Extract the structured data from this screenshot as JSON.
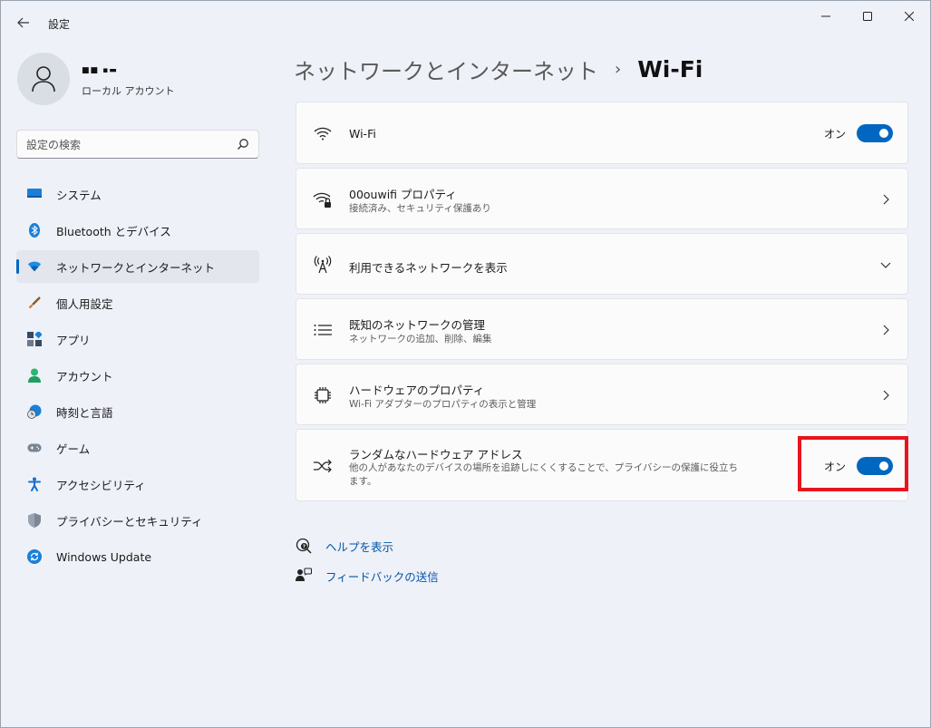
{
  "window": {
    "title": "設定",
    "controls": [
      "minimize-icon",
      "maximize-icon",
      "close-icon"
    ]
  },
  "user": {
    "name": "■■ ▪▬",
    "account_type": "ローカル アカウント"
  },
  "search": {
    "placeholder": "設定の検索"
  },
  "sidebar": {
    "items": [
      {
        "label": "システム",
        "icon": "system-icon",
        "active": false
      },
      {
        "label": "Bluetooth とデバイス",
        "icon": "bluetooth-icon",
        "active": false
      },
      {
        "label": "ネットワークとインターネット",
        "icon": "network-icon",
        "active": true
      },
      {
        "label": "個人用設定",
        "icon": "brush-icon",
        "active": false
      },
      {
        "label": "アプリ",
        "icon": "apps-icon",
        "active": false
      },
      {
        "label": "アカウント",
        "icon": "account-icon",
        "active": false
      },
      {
        "label": "時刻と言語",
        "icon": "time-language-icon",
        "active": false
      },
      {
        "label": "ゲーム",
        "icon": "gamepad-icon",
        "active": false
      },
      {
        "label": "アクセシビリティ",
        "icon": "accessibility-icon",
        "active": false
      },
      {
        "label": "プライバシーとセキュリティ",
        "icon": "shield-icon",
        "active": false
      },
      {
        "label": "Windows Update",
        "icon": "windows-update-icon",
        "active": false
      }
    ]
  },
  "breadcrumb": {
    "parent": "ネットワークとインターネット",
    "separator": "›",
    "current": "Wi-Fi"
  },
  "main": {
    "wifi": {
      "title": "Wi-Fi",
      "toggle_label": "オン",
      "toggle_on": true
    },
    "properties": {
      "title": "00ouwifi プロパティ",
      "subtitle": "接続済み、セキュリティ保護あり"
    },
    "available": {
      "title": "利用できるネットワークを表示"
    },
    "known": {
      "title": "既知のネットワークの管理",
      "subtitle": "ネットワークの追加、削除、編集"
    },
    "hardware": {
      "title": "ハードウェアのプロパティ",
      "subtitle": "Wi-Fi アダプターのプロパティの表示と管理"
    },
    "random_mac": {
      "title": "ランダムなハードウェア アドレス",
      "subtitle": "他の人があなたのデバイスの場所を追跡しにくくすることで、プライバシーの保護に役立ちます。",
      "toggle_label": "オン",
      "toggle_on": true
    }
  },
  "links": {
    "help": "ヘルプを表示",
    "feedback": "フィードバックの送信"
  },
  "colors": {
    "accent": "#0067c0",
    "highlight_box": "#e8141f",
    "link": "#0055a8"
  }
}
